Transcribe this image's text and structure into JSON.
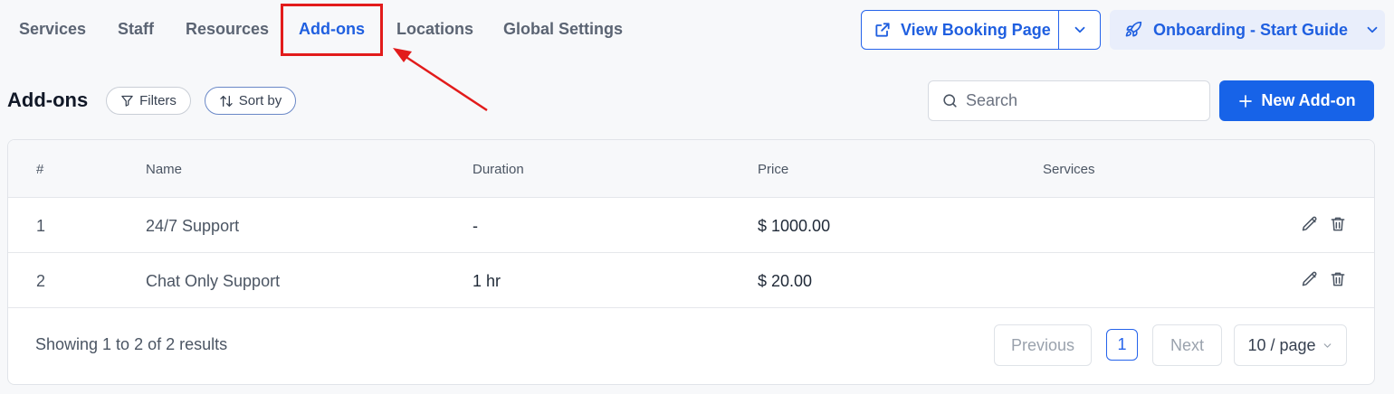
{
  "nav": {
    "tabs": [
      {
        "label": "Services"
      },
      {
        "label": "Staff"
      },
      {
        "label": "Resources"
      },
      {
        "label": "Add-ons"
      },
      {
        "label": "Locations"
      },
      {
        "label": "Global Settings"
      }
    ],
    "active_tab": "Add-ons"
  },
  "header": {
    "view_booking_label": "View Booking Page",
    "onboarding_label": "Onboarding - Start Guide"
  },
  "toolbar": {
    "title": "Add-ons",
    "filters_label": "Filters",
    "sort_label": "Sort by",
    "search_placeholder": "Search",
    "new_label": "New Add-on"
  },
  "table": {
    "columns": [
      "#",
      "Name",
      "Duration",
      "Price",
      "Services"
    ],
    "rows": [
      {
        "num": "1",
        "name": "24/7 Support",
        "duration": "-",
        "price": "$ 1000.00"
      },
      {
        "num": "2",
        "name": "Chat Only Support",
        "duration": "1 hr",
        "price": "$ 20.00"
      }
    ]
  },
  "pagination": {
    "summary": "Showing 1 to 2 of 2 results",
    "previous_label": "Previous",
    "current_page": "1",
    "next_label": "Next",
    "page_size_label": "10 / page"
  },
  "colors": {
    "accent": "#1f5fe0",
    "primary_button": "#1763e8",
    "annotation": "#e21b1b"
  },
  "icons": [
    "external-link-icon",
    "chevron-down-icon",
    "rocket-icon",
    "filter-icon",
    "sort-icon",
    "search-icon",
    "plus-icon",
    "edit-icon",
    "trash-icon",
    "annotation-arrow"
  ]
}
